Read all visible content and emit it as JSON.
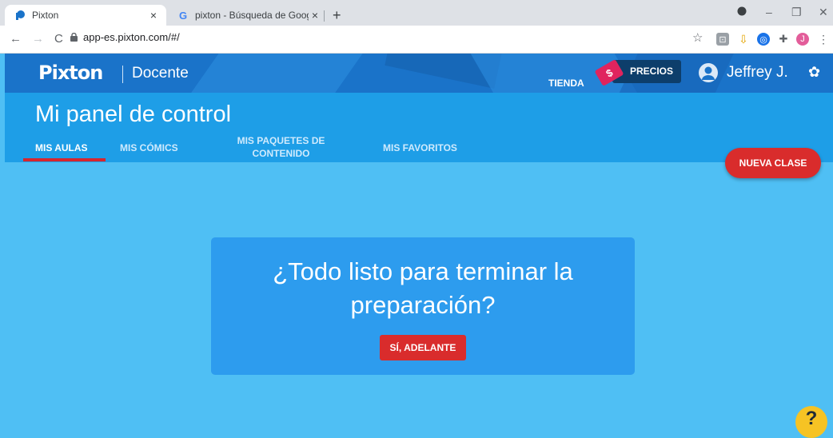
{
  "browser": {
    "tabs": [
      {
        "title": "Pixton",
        "close": "×"
      },
      {
        "title": "pixton - Búsqueda de Google",
        "close": "×"
      }
    ],
    "new_tab": "+",
    "url": "app-es.pixton.com/#/",
    "window_controls": {
      "minimize": "–",
      "restore": "❐",
      "close": "✕"
    },
    "nav": {
      "back": "←",
      "forward": "→",
      "reload": "C"
    },
    "extensions": {
      "star": "☆",
      "profile_initial": "J",
      "menu": "⋮"
    }
  },
  "header": {
    "logo": "Pixton",
    "divider": "|",
    "role": "Docente",
    "store": "TIENDA",
    "prices": "PRECIOS",
    "tag_symbol": "$",
    "user": "Jeffrey J.",
    "gear_icon": "✿"
  },
  "subheader": {
    "title": "Mi panel de control",
    "tabs": [
      {
        "label": "MIS AULAS"
      },
      {
        "label": "MIS CÓMICS"
      },
      {
        "label": "MIS PAQUETES DE CONTENIDO"
      },
      {
        "label": "MIS FAVORITOS"
      }
    ],
    "new_class": "NUEVA CLASE"
  },
  "card": {
    "heading": "¿Todo listo para terminar la preparación?",
    "button": "SÍ, ADELANTE"
  },
  "help": "?",
  "colors": {
    "header_bg": "#1a73c9",
    "subheader_bg": "#1e9ee7",
    "page_bg": "#4fbff4",
    "card_bg": "#2d9cee",
    "accent_red": "#d92c2c",
    "help_yellow": "#f6c324"
  }
}
